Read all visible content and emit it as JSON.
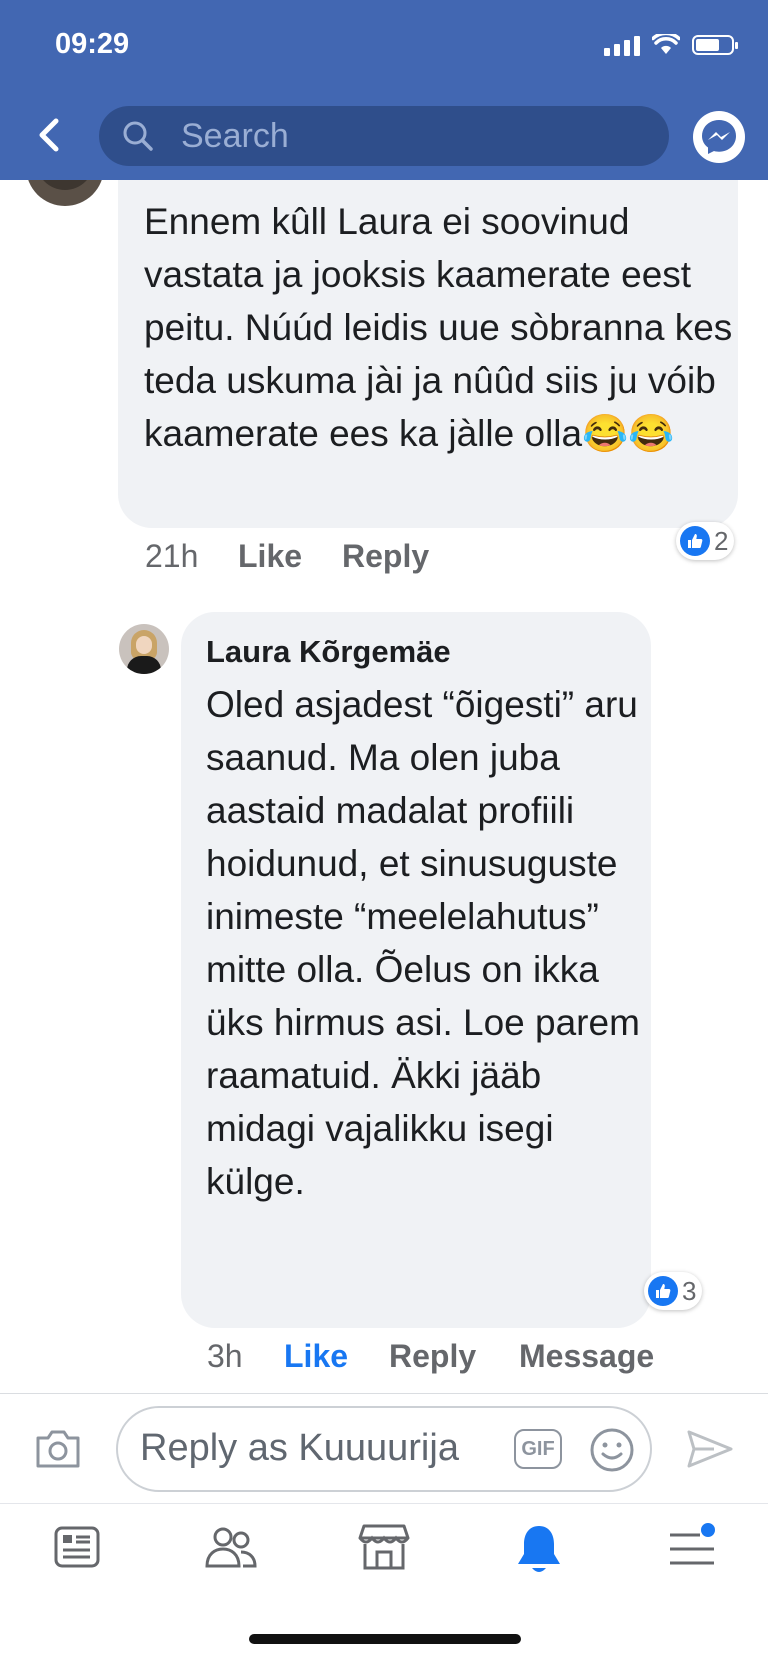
{
  "status_bar": {
    "time": "09:29"
  },
  "header": {
    "search_placeholder": "Search"
  },
  "comment_top": {
    "text": "Ennem kûll Laura ei soovinud vastata ja jooksis kaamerate eest peitu. Núúd leidis uue sòbranna kes teda uskuma jài ja nûûd siis ju vóib kaamerate ees ka jàlle olla😂😂",
    "time": "21h",
    "like_label": "Like",
    "reply_label": "Reply",
    "reaction_count": "2"
  },
  "reply_comment": {
    "author": "Laura Kõrgemäe",
    "text": "Oled asjadest “õigesti” aru saanud. Ma olen juba aastaid madalat profiili hoidunud, et sinusuguste inimeste “meelelahutus” mitte olla. Õelus on ikka üks hirmus asi. Loe parem raamatuid. Äkki jääb midagi vajalikku isegi külge.",
    "time": "3h",
    "like_label": "Like",
    "reply_label": "Reply",
    "message_label": "Message",
    "reaction_count": "3"
  },
  "composer": {
    "placeholder": "Reply as Kuuuurija",
    "gif_label": "GIF"
  },
  "tabbar": {
    "items": [
      {
        "icon": "news-feed-icon"
      },
      {
        "icon": "friends-icon"
      },
      {
        "icon": "marketplace-icon"
      },
      {
        "icon": "notifications-bell-icon",
        "active": true
      },
      {
        "icon": "menu-icon"
      }
    ]
  },
  "colors": {
    "header_blue": "#4267B2",
    "accent": "#1877f2",
    "bubble": "#f0f2f5"
  }
}
